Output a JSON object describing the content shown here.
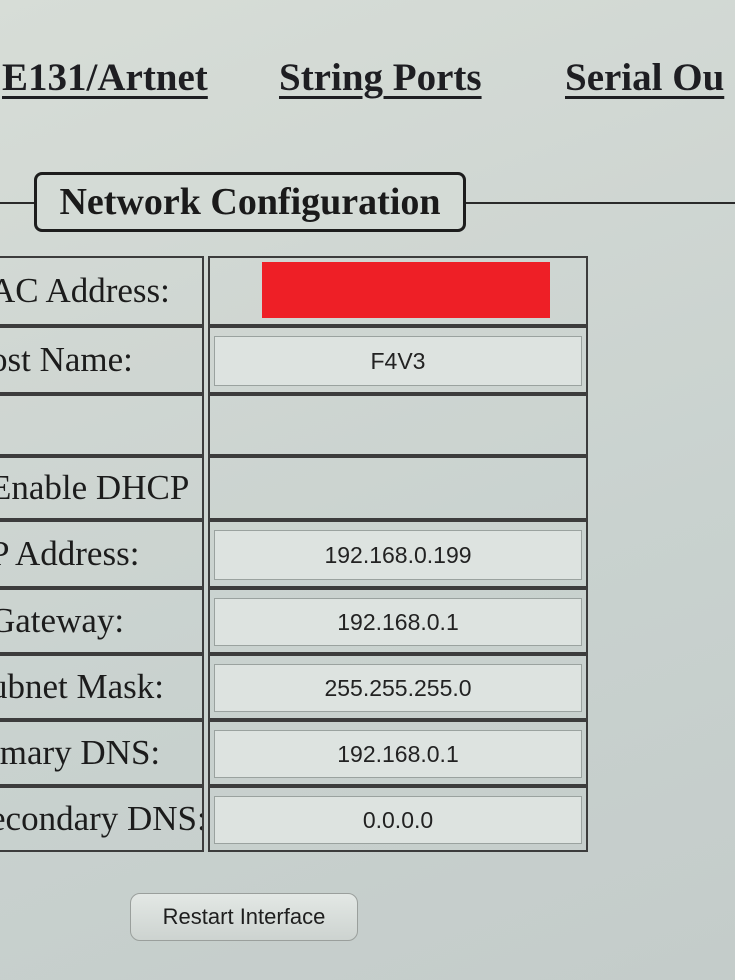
{
  "nav": {
    "tabs": [
      {
        "label": "E131/Artnet"
      },
      {
        "label": "String Ports"
      },
      {
        "label": "Serial Ou"
      }
    ]
  },
  "section": {
    "title": "Network Configuration"
  },
  "fields": [
    {
      "label": "AC Address:",
      "value": ""
    },
    {
      "label": "ost Name:",
      "value": "F4V3"
    },
    {
      "label": "",
      "value": ""
    },
    {
      "label": "Enable DHCP",
      "value": ""
    },
    {
      "label": "P Address:",
      "value": "192.168.0.199"
    },
    {
      "label": "Gateway:",
      "value": "192.168.0.1"
    },
    {
      "label": "ubnet Mask:",
      "value": "255.255.255.0"
    },
    {
      "label": "imary DNS:",
      "value": "192.168.0.1"
    },
    {
      "label": "econdary DNS:",
      "value": "0.0.0.0"
    }
  ],
  "actions": {
    "restart_label": "Restart Interface"
  },
  "colors": {
    "redaction": "#ee1f26"
  }
}
